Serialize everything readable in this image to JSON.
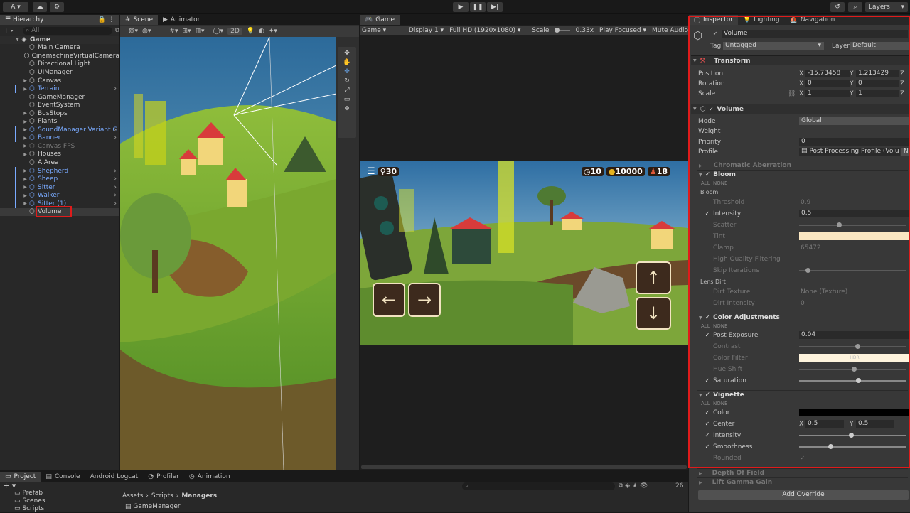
{
  "toolbar": {
    "account": "A",
    "layers": "Layers"
  },
  "hierarchy": {
    "tab": "Hierarchy",
    "search_placeholder": "All",
    "root": "Game",
    "items": [
      {
        "label": "Main Camera",
        "style": "normal",
        "arrow": false
      },
      {
        "label": "CinemachineVirtualCamera",
        "style": "normal",
        "arrow": false
      },
      {
        "label": "Directional Light",
        "style": "normal",
        "arrow": false
      },
      {
        "label": "UIManager",
        "style": "normal",
        "arrow": false
      },
      {
        "label": "Canvas",
        "style": "normal",
        "arrow": true
      },
      {
        "label": "Terrain",
        "style": "blue",
        "arrow": true
      },
      {
        "label": "GameManager",
        "style": "normal",
        "arrow": false
      },
      {
        "label": "EventSystem",
        "style": "normal",
        "arrow": false
      },
      {
        "label": "BusStops",
        "style": "normal",
        "arrow": true
      },
      {
        "label": "Plants",
        "style": "normal",
        "arrow": true
      },
      {
        "label": "SoundManager Variant G",
        "style": "blue",
        "arrow": true
      },
      {
        "label": "Banner",
        "style": "blue",
        "arrow": true
      },
      {
        "label": "Canvas FPS",
        "style": "grey",
        "arrow": true
      },
      {
        "label": "Houses",
        "style": "normal",
        "arrow": true
      },
      {
        "label": "AIArea",
        "style": "normal",
        "arrow": false
      },
      {
        "label": "Shepherd",
        "style": "blue",
        "arrow": true
      },
      {
        "label": "Sheep",
        "style": "blue",
        "arrow": true
      },
      {
        "label": "Sitter",
        "style": "blue",
        "arrow": true
      },
      {
        "label": "Walker",
        "style": "blue",
        "arrow": true
      },
      {
        "label": "Sitter (1)",
        "style": "blue",
        "arrow": true
      },
      {
        "label": "Volume",
        "style": "normal",
        "arrow": false
      }
    ]
  },
  "scene": {
    "tab_scene": "Scene",
    "tab_animator": "Animator",
    "mode_2d": "2D"
  },
  "game": {
    "tab": "Game",
    "mode": "Game",
    "display": "Display 1",
    "resolution": "Full HD (1920x1080)",
    "scale_label": "Scale",
    "scale_value": "0.33x",
    "play_focused": "Play Focused",
    "mute": "Mute Audio",
    "hud": {
      "passengers": "30",
      "timer": "10",
      "coins": "10000",
      "people": "18"
    }
  },
  "inspector": {
    "tabs": [
      "Inspector",
      "Lighting",
      "Navigation"
    ],
    "object_name": "Volume",
    "tag_label": "Tag",
    "tag_value": "Untagged",
    "layer_label": "Layer",
    "layer_value": "Default",
    "transform": {
      "title": "Transform",
      "position_label": "Position",
      "rotation_label": "Rotation",
      "scale_label": "Scale",
      "px": "-15.73458",
      "py": "1.213429",
      "rx": "0",
      "ry": "0",
      "sx": "1",
      "sy": "1"
    },
    "volume": {
      "title": "Volume",
      "mode_label": "Mode",
      "mode_value": "Global",
      "weight_label": "Weight",
      "priority_label": "Priority",
      "priority_value": "0",
      "profile_label": "Profile",
      "profile_value": "Post Processing Profile (Volu",
      "new_btn": "N"
    },
    "chromatic": "Chromatic Aberration",
    "bloom": {
      "title": "Bloom",
      "all": "ALL",
      "none": "NONE",
      "group": "Bloom",
      "threshold_label": "Threshold",
      "threshold_value": "0.9",
      "intensity_label": "Intensity",
      "intensity_value": "0.5",
      "scatter_label": "Scatter",
      "tint_label": "Tint",
      "clamp_label": "Clamp",
      "clamp_value": "65472",
      "hq_label": "High Quality Filtering",
      "skip_label": "Skip Iterations",
      "lens_group": "Lens Dirt",
      "dirt_tex_label": "Dirt Texture",
      "dirt_tex_value": "None (Texture)",
      "dirt_int_label": "Dirt Intensity",
      "dirt_int_value": "0"
    },
    "color_adj": {
      "title": "Color Adjustments",
      "all": "ALL",
      "none": "NONE",
      "post_label": "Post Exposure",
      "post_value": "0.04",
      "contrast_label": "Contrast",
      "filter_label": "Color Filter",
      "filter_hdr": "HDR",
      "hue_label": "Hue Shift",
      "sat_label": "Saturation"
    },
    "vignette": {
      "title": "Vignette",
      "all": "ALL",
      "none": "NONE",
      "color_label": "Color",
      "center_label": "Center",
      "cx": "0.5",
      "cy": "0.5",
      "intensity_label": "Intensity",
      "smooth_label": "Smoothness",
      "rounded_label": "Rounded"
    },
    "dof": "Depth Of Field",
    "lgg": "Lift Gamma Gain",
    "add_override": "Add Override"
  },
  "bottom": {
    "tabs": [
      "Project",
      "Console",
      "Android Logcat",
      "Profiler",
      "Animation"
    ],
    "tree": [
      "Prefab",
      "Scenes",
      "Scripts"
    ],
    "breadcrumb": [
      "Assets",
      "Scripts",
      "Managers"
    ],
    "file": "GameManager",
    "count": "26"
  },
  "colors": {
    "selection_red": "#e01b1b",
    "accent_blue": "#79aaff"
  }
}
